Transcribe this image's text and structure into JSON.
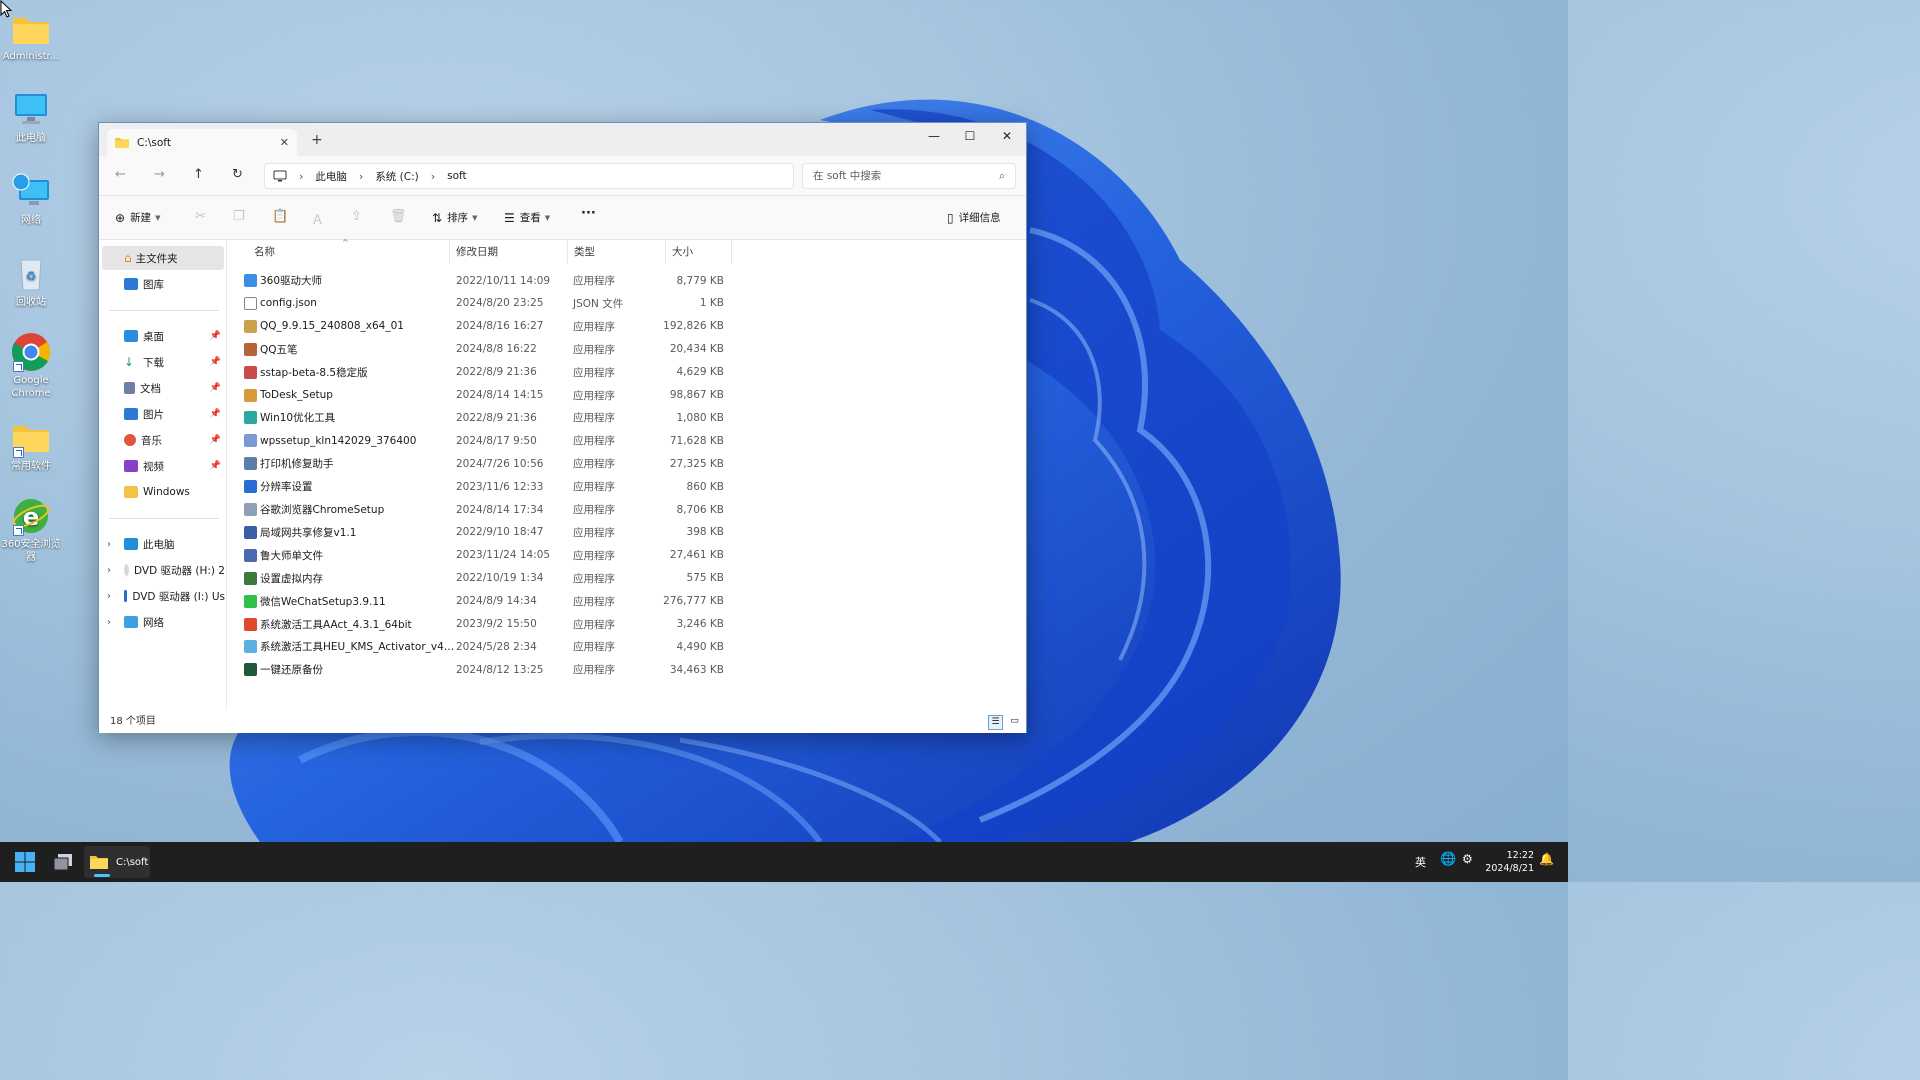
{
  "desktop": {
    "icons": [
      {
        "label": "Administr..."
      },
      {
        "label": "此电脑"
      },
      {
        "label": "网络"
      },
      {
        "label": "回收站"
      },
      {
        "label": "Google Chrome"
      },
      {
        "label": "常用软件"
      },
      {
        "label": "360安全浏览器"
      }
    ]
  },
  "window": {
    "tab_title": "C:\\soft",
    "tab_close": "✕",
    "new_tab": "+",
    "controls": {
      "minimize": "—",
      "maximize": "☐",
      "close": "✕"
    },
    "breadcrumb": [
      {
        "label": "此电脑"
      },
      {
        "label": "系统 (C:)"
      },
      {
        "label": "soft"
      }
    ],
    "search_placeholder": "在 soft 中搜索",
    "toolbar": {
      "new_label": "新建",
      "sort_label": "排序",
      "view_label": "查看",
      "more_label": "···",
      "details_label": "详细信息"
    },
    "nav_pane": {
      "home": "主文件夹",
      "gallery": "图库",
      "quick": [
        {
          "label": "桌面",
          "color": "#2a8de0"
        },
        {
          "label": "下载",
          "color": "#1f9e57"
        },
        {
          "label": "文档",
          "color": "#6e7fa3"
        },
        {
          "label": "图片",
          "color": "#2b7bd6"
        },
        {
          "label": "音乐",
          "color": "#e0553c"
        },
        {
          "label": "视频",
          "color": "#8a3fc9"
        },
        {
          "label": "Windows",
          "color": "#f2c443"
        }
      ],
      "drives": [
        {
          "label": "此电脑"
        },
        {
          "label": "DVD 驱动器 (H:) 2"
        },
        {
          "label": "DVD 驱动器 (I:) Us"
        },
        {
          "label": "网络"
        }
      ]
    },
    "columns": {
      "name": "名称",
      "date": "修改日期",
      "type": "类型",
      "size": "大小"
    },
    "files": [
      {
        "name": "360驱动大师",
        "date": "2022/10/11 14:09",
        "type": "应用程序",
        "size": "8,779 KB",
        "color": "#3a8ee6"
      },
      {
        "name": "config.json",
        "date": "2024/8/20 23:25",
        "type": "JSON 文件",
        "size": "1 KB",
        "color": "#ffffff"
      },
      {
        "name": "QQ_9.9.15_240808_x64_01",
        "date": "2024/8/16 16:27",
        "type": "应用程序",
        "size": "192,826 KB",
        "color": "#c9a24a"
      },
      {
        "name": "QQ五笔",
        "date": "2024/8/8 16:22",
        "type": "应用程序",
        "size": "20,434 KB",
        "color": "#b5643a"
      },
      {
        "name": "sstap-beta-8.5稳定版",
        "date": "2022/8/9 21:36",
        "type": "应用程序",
        "size": "4,629 KB",
        "color": "#c94a4a"
      },
      {
        "name": "ToDesk_Setup",
        "date": "2024/8/14 14:15",
        "type": "应用程序",
        "size": "98,867 KB",
        "color": "#d69b3a"
      },
      {
        "name": "Win10优化工具",
        "date": "2022/8/9 21:36",
        "type": "应用程序",
        "size": "1,080 KB",
        "color": "#2aa7a0"
      },
      {
        "name": "wpssetup_kln142029_376400",
        "date": "2024/8/17 9:50",
        "type": "应用程序",
        "size": "71,628 KB",
        "color": "#7a9ad6"
      },
      {
        "name": "打印机修复助手",
        "date": "2024/7/26 10:56",
        "type": "应用程序",
        "size": "27,325 KB",
        "color": "#5a7fa8"
      },
      {
        "name": "分辨率设置",
        "date": "2023/11/6 12:33",
        "type": "应用程序",
        "size": "860 KB",
        "color": "#2a6bd6"
      },
      {
        "name": "谷歌浏览器ChromeSetup",
        "date": "2024/8/14 17:34",
        "type": "应用程序",
        "size": "8,706 KB",
        "color": "#8f9fb8"
      },
      {
        "name": "局域网共享修复v1.1",
        "date": "2022/9/10 18:47",
        "type": "应用程序",
        "size": "398 KB",
        "color": "#3a5fa8"
      },
      {
        "name": "鲁大师单文件",
        "date": "2023/11/24 14:05",
        "type": "应用程序",
        "size": "27,461 KB",
        "color": "#4a6ab0"
      },
      {
        "name": "设置虚拟内存",
        "date": "2022/10/19 1:34",
        "type": "应用程序",
        "size": "575 KB",
        "color": "#3a7a3a"
      },
      {
        "name": "微信WeChatSetup3.9.11",
        "date": "2024/8/9 14:34",
        "type": "应用程序",
        "size": "276,777 KB",
        "color": "#2fbf4a"
      },
      {
        "name": "系统激活工具AAct_4.3.1_64bit",
        "date": "2023/9/2 15:50",
        "type": "应用程序",
        "size": "3,246 KB",
        "color": "#e04a2a"
      },
      {
        "name": "系统激活工具HEU_KMS_Activator_v42....",
        "date": "2024/5/28 2:34",
        "type": "应用程序",
        "size": "4,490 KB",
        "color": "#5ab0e0"
      },
      {
        "name": "一键还原备份",
        "date": "2024/8/12 13:25",
        "type": "应用程序",
        "size": "34,463 KB",
        "color": "#1e5a3a"
      }
    ],
    "status": "18 个项目"
  },
  "taskbar": {
    "active_window": "C:\\soft",
    "ime": "英",
    "time": "12:22",
    "date": "2024/8/21"
  }
}
